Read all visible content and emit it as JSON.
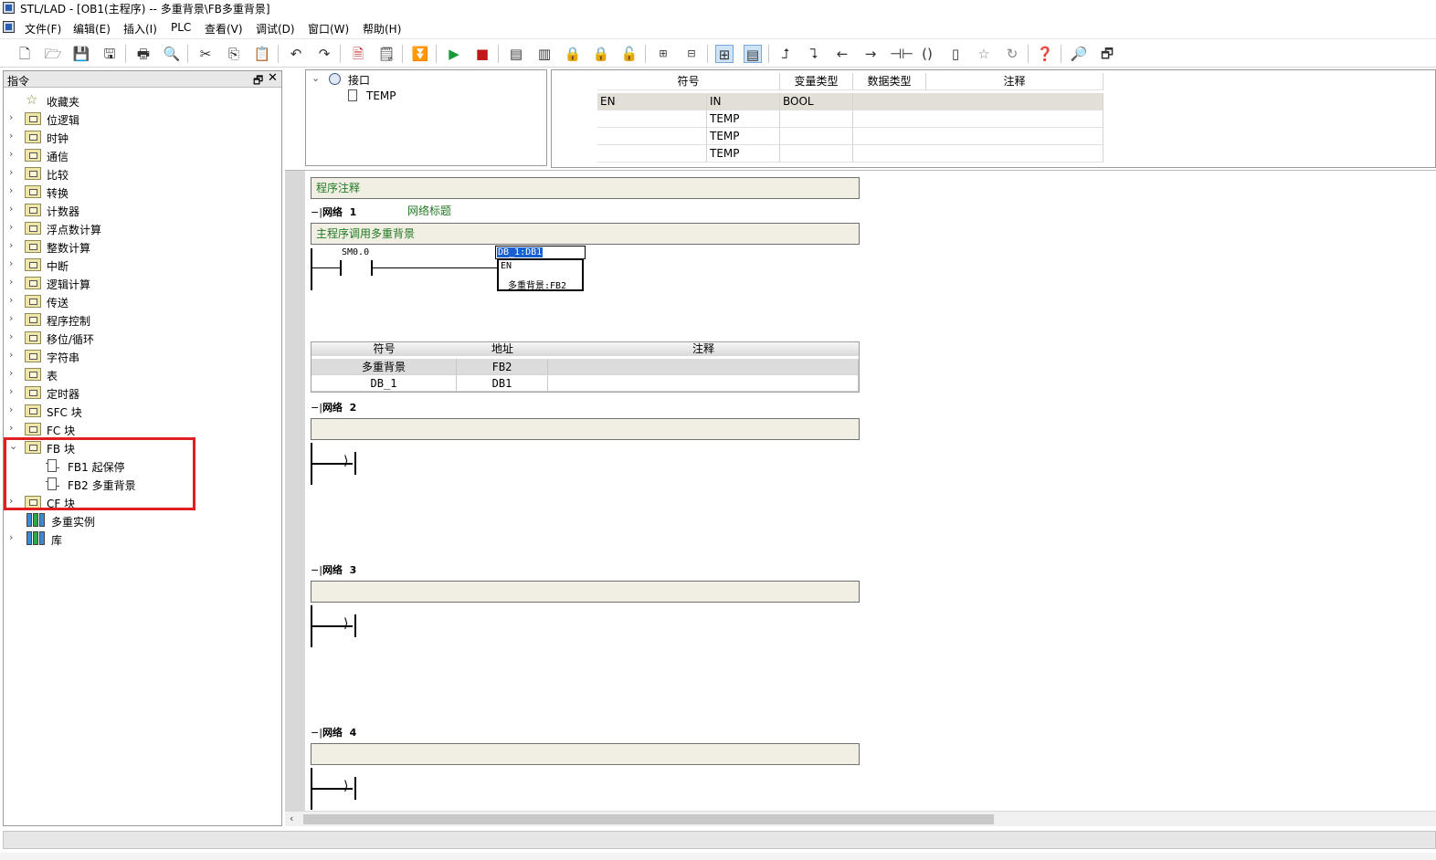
{
  "window": {
    "title": "STL/LAD - [OB1(主程序) -- 多重背景\\FB多重背景]"
  },
  "menu": [
    "文件(F)",
    "编辑(E)",
    "插入(I)",
    "PLC",
    "查看(V)",
    "调试(D)",
    "窗口(W)",
    "帮助(H)"
  ],
  "left_panel": {
    "title": "指令",
    "pin": "🗗",
    "close": "✕",
    "items": [
      {
        "label": "收藏夹"
      },
      {
        "label": "位逻辑"
      },
      {
        "label": "时钟"
      },
      {
        "label": "通信"
      },
      {
        "label": "比较"
      },
      {
        "label": "转换"
      },
      {
        "label": "计数器"
      },
      {
        "label": "浮点数计算"
      },
      {
        "label": "整数计算"
      },
      {
        "label": "中断"
      },
      {
        "label": "逻辑计算"
      },
      {
        "label": "传送"
      },
      {
        "label": "程序控制"
      },
      {
        "label": "移位/循环"
      },
      {
        "label": "字符串"
      },
      {
        "label": "表"
      },
      {
        "label": "定时器"
      },
      {
        "label": "SFC 块"
      },
      {
        "label": "FC 块"
      },
      {
        "label": "FB 块"
      },
      {
        "label": "FB1  起保停"
      },
      {
        "label": "FB2  多重背景"
      },
      {
        "label": "CF 块"
      },
      {
        "label": "多重实例"
      },
      {
        "label": "库"
      }
    ]
  },
  "interface": {
    "root": "接口",
    "child": "TEMP",
    "columns": [
      "符号",
      "变量类型",
      "数据类型",
      "注释"
    ],
    "rows": [
      [
        "EN",
        "IN",
        "BOOL",
        ""
      ],
      [
        "",
        "TEMP",
        "",
        ""
      ],
      [
        "",
        "TEMP",
        "",
        ""
      ],
      [
        "",
        "TEMP",
        "",
        ""
      ]
    ]
  },
  "editor": {
    "program_comment": "程序注释",
    "networks": [
      {
        "label": "网络",
        "number": "1",
        "title": "网络标题",
        "comment": "主程序调用多重背景",
        "contact": "SM0.0",
        "block_instance": "DB_1:DB1",
        "block_en": "EN",
        "block_name": "多重背景:FB2"
      },
      {
        "label": "网络",
        "number": "2",
        "comment": ""
      },
      {
        "label": "网络",
        "number": "3",
        "comment": ""
      },
      {
        "label": "网络",
        "number": "4",
        "comment": ""
      }
    ],
    "symbol_table": {
      "columns": [
        "符号",
        "地址",
        "注释"
      ],
      "rows": [
        [
          "多重背景",
          "FB2",
          ""
        ],
        [
          "DB_1",
          "DB1",
          ""
        ]
      ]
    }
  },
  "colors": {
    "highlight": "#e02020",
    "comment_text": "#227a22",
    "comment_bg": "#f1efe4"
  }
}
